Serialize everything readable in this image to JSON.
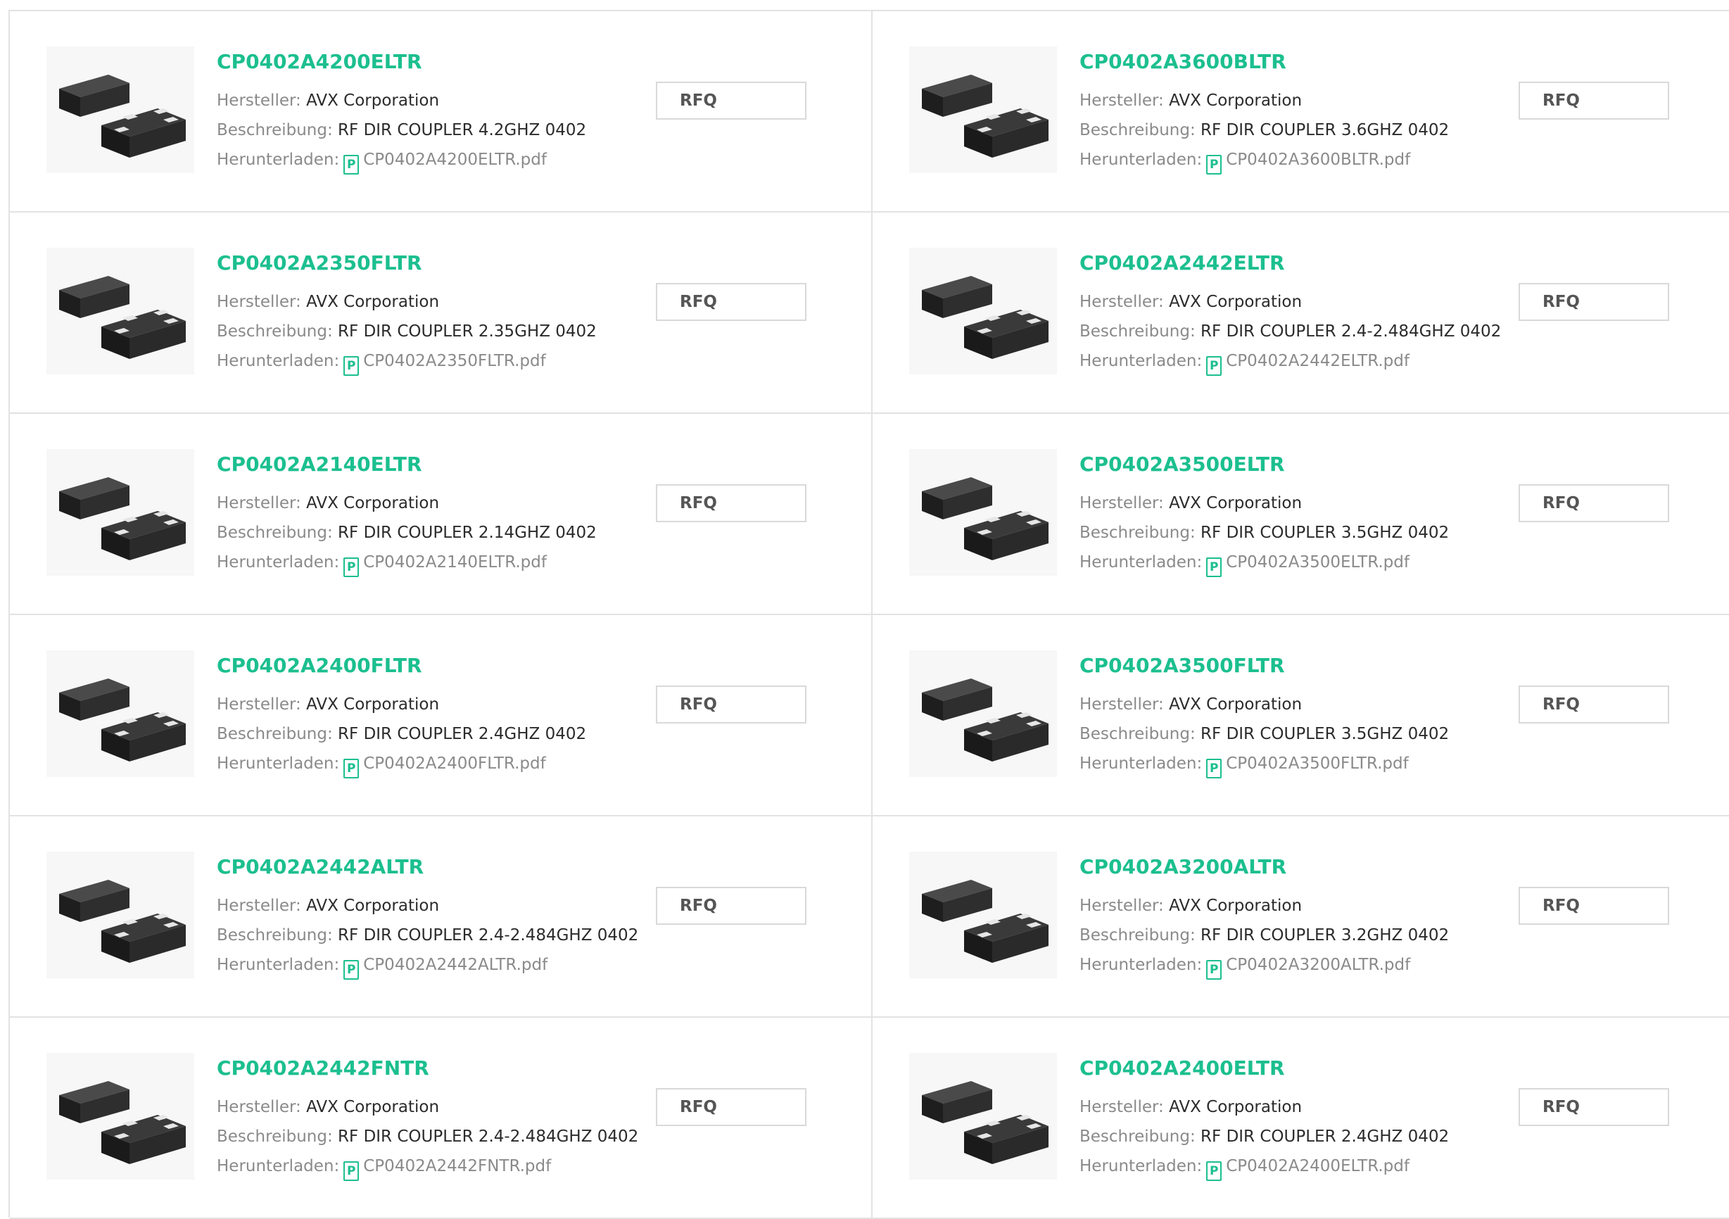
{
  "labels": {
    "manufacturer": "Hersteller:",
    "description": "Beschreibung:",
    "download": "Herunterladen:",
    "rfq": "RFQ",
    "pdf_glyph": "P"
  },
  "colors": {
    "accent": "#1cbf8f",
    "label_gray": "#8a8a8a",
    "value_dark": "#2b2b2b",
    "border": "#e2e2e2"
  },
  "icons": {
    "product_image": "chip-package-icon",
    "pdf": "pdf-icon"
  },
  "products": [
    {
      "part": "CP0402A4200ELTR",
      "manufacturer": "AVX Corporation",
      "description": "RF DIR COUPLER 4.2GHZ 0402",
      "pdf": "CP0402A4200ELTR.pdf"
    },
    {
      "part": "CP0402A3600BLTR",
      "manufacturer": "AVX Corporation",
      "description": "RF DIR COUPLER 3.6GHZ 0402",
      "pdf": "CP0402A3600BLTR.pdf"
    },
    {
      "part": "CP0402A2350FLTR",
      "manufacturer": "AVX Corporation",
      "description": "RF DIR COUPLER 2.35GHZ 0402",
      "pdf": "CP0402A2350FLTR.pdf"
    },
    {
      "part": "CP0402A2442ELTR",
      "manufacturer": "AVX Corporation",
      "description": "RF DIR COUPLER 2.4-2.484GHZ 0402",
      "pdf": "CP0402A2442ELTR.pdf"
    },
    {
      "part": "CP0402A2140ELTR",
      "manufacturer": "AVX Corporation",
      "description": "RF DIR COUPLER 2.14GHZ 0402",
      "pdf": "CP0402A2140ELTR.pdf"
    },
    {
      "part": "CP0402A3500ELTR",
      "manufacturer": "AVX Corporation",
      "description": "RF DIR COUPLER 3.5GHZ 0402",
      "pdf": "CP0402A3500ELTR.pdf"
    },
    {
      "part": "CP0402A2400FLTR",
      "manufacturer": "AVX Corporation",
      "description": "RF DIR COUPLER 2.4GHZ 0402",
      "pdf": "CP0402A2400FLTR.pdf"
    },
    {
      "part": "CP0402A3500FLTR",
      "manufacturer": "AVX Corporation",
      "description": "RF DIR COUPLER 3.5GHZ 0402",
      "pdf": "CP0402A3500FLTR.pdf"
    },
    {
      "part": "CP0402A2442ALTR",
      "manufacturer": "AVX Corporation",
      "description": "RF DIR COUPLER 2.4-2.484GHZ 0402",
      "pdf": "CP0402A2442ALTR.pdf"
    },
    {
      "part": "CP0402A3200ALTR",
      "manufacturer": "AVX Corporation",
      "description": "RF DIR COUPLER 3.2GHZ 0402",
      "pdf": "CP0402A3200ALTR.pdf"
    },
    {
      "part": "CP0402A2442FNTR",
      "manufacturer": "AVX Corporation",
      "description": "RF DIR COUPLER 2.4-2.484GHZ 0402",
      "pdf": "CP0402A2442FNTR.pdf"
    },
    {
      "part": "CP0402A2400ELTR",
      "manufacturer": "AVX Corporation",
      "description": "RF DIR COUPLER 2.4GHZ 0402",
      "pdf": "CP0402A2400ELTR.pdf"
    }
  ]
}
